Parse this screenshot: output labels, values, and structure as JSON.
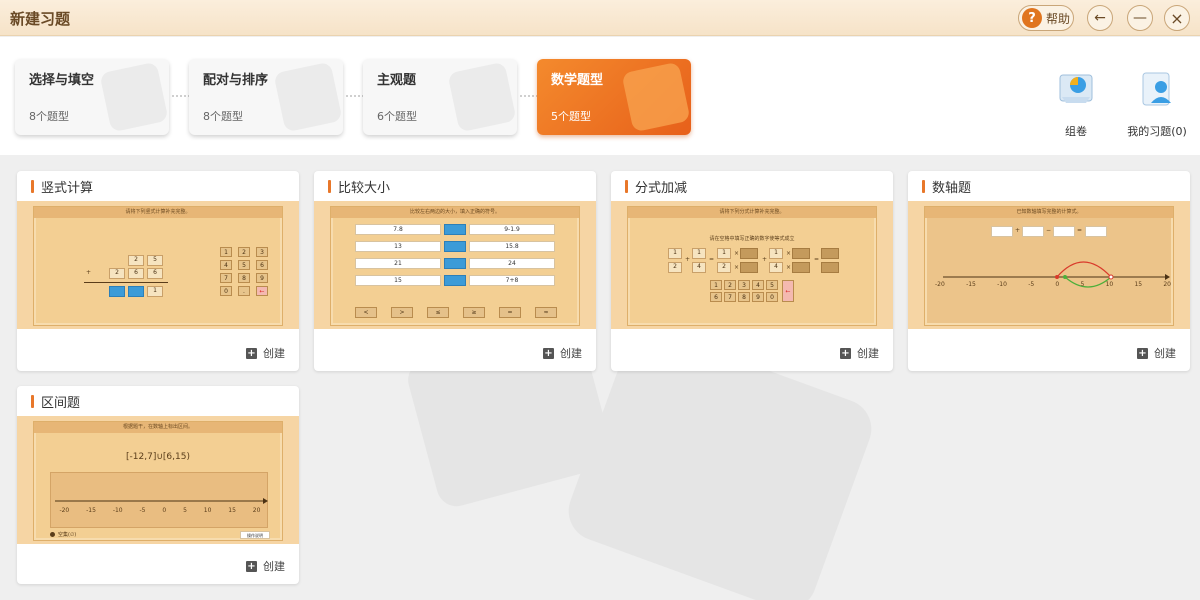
{
  "window": {
    "title": "新建习题"
  },
  "titlebar": {
    "help_label": "帮助",
    "back_glyph": "←",
    "minimize_glyph": "—",
    "close_glyph": "×"
  },
  "categories": [
    {
      "name": "选择与填空",
      "count": "8个题型",
      "active": false
    },
    {
      "name": "配对与排序",
      "count": "8个题型",
      "active": false
    },
    {
      "name": "主观题",
      "count": "6个题型",
      "active": false
    },
    {
      "name": "数学题型",
      "count": "5个题型",
      "active": true
    }
  ],
  "actions": [
    {
      "label": "组卷",
      "icon": "paper-assemble-icon"
    },
    {
      "label": "我的习题(0)",
      "icon": "my-exercises-icon"
    }
  ],
  "create_label": "创建",
  "cards": [
    {
      "title": "竖式计算",
      "instruction": "请将下列竖式计算补充完整。",
      "row1": [
        "2",
        "5"
      ],
      "plus": "+",
      "row2": [
        "2",
        "6",
        "6"
      ],
      "result_last": "1",
      "keypad": [
        "1",
        "2",
        "3",
        "4",
        "5",
        "6",
        "7",
        "8",
        "9",
        "0",
        ".",
        "←"
      ]
    },
    {
      "title": "比较大小",
      "instruction": "比较左右两边的大小，填入正确的符号。",
      "rows": [
        {
          "left": "7.8",
          "right": "9-1.9"
        },
        {
          "left": "13",
          "right": "15.8"
        },
        {
          "left": "21",
          "right": "24"
        },
        {
          "left": "15",
          "right": "7+8"
        }
      ],
      "symbols": [
        "<",
        ">",
        "≤",
        "≥",
        "=",
        "≈"
      ]
    },
    {
      "title": "分式加减",
      "instruction": "请将下列分式计算补充完整。",
      "subinstruction": "请在空格中填写正确的数字使等式成立",
      "fractions": {
        "a_num": "1",
        "a_den": "2",
        "plus": "+",
        "b_num": "1",
        "b_den": "4",
        "eq": "=",
        "c_num": "1",
        "c_den": "2",
        "times": "×",
        "plus2": "+",
        "d_num": "1",
        "d_den": "4",
        "eq2": "="
      },
      "keypad": [
        "1",
        "2",
        "3",
        "4",
        "5",
        "6",
        "7",
        "8",
        "9",
        "0",
        "←"
      ]
    },
    {
      "title": "数轴题",
      "instruction": "已知数轴填写完整的计算式。",
      "ops": [
        "+",
        "−",
        "="
      ],
      "ticks": [
        "-20",
        "-15",
        "-10",
        "-5",
        "0",
        "5",
        "10",
        "15",
        "20"
      ]
    },
    {
      "title": "区间题",
      "instruction": "根据题干，在数轴上标出区间。",
      "expression": "[-12,7]∪[6,15)",
      "ticks": [
        "-20",
        "-15",
        "-10",
        "-5",
        "0",
        "5",
        "10",
        "15",
        "20"
      ],
      "legend": "空集(∅)",
      "button": "操作说明"
    }
  ],
  "colors": {
    "accent": "#e8772a",
    "titlebar": "#f6e3c8",
    "board": "#f3cf93"
  }
}
